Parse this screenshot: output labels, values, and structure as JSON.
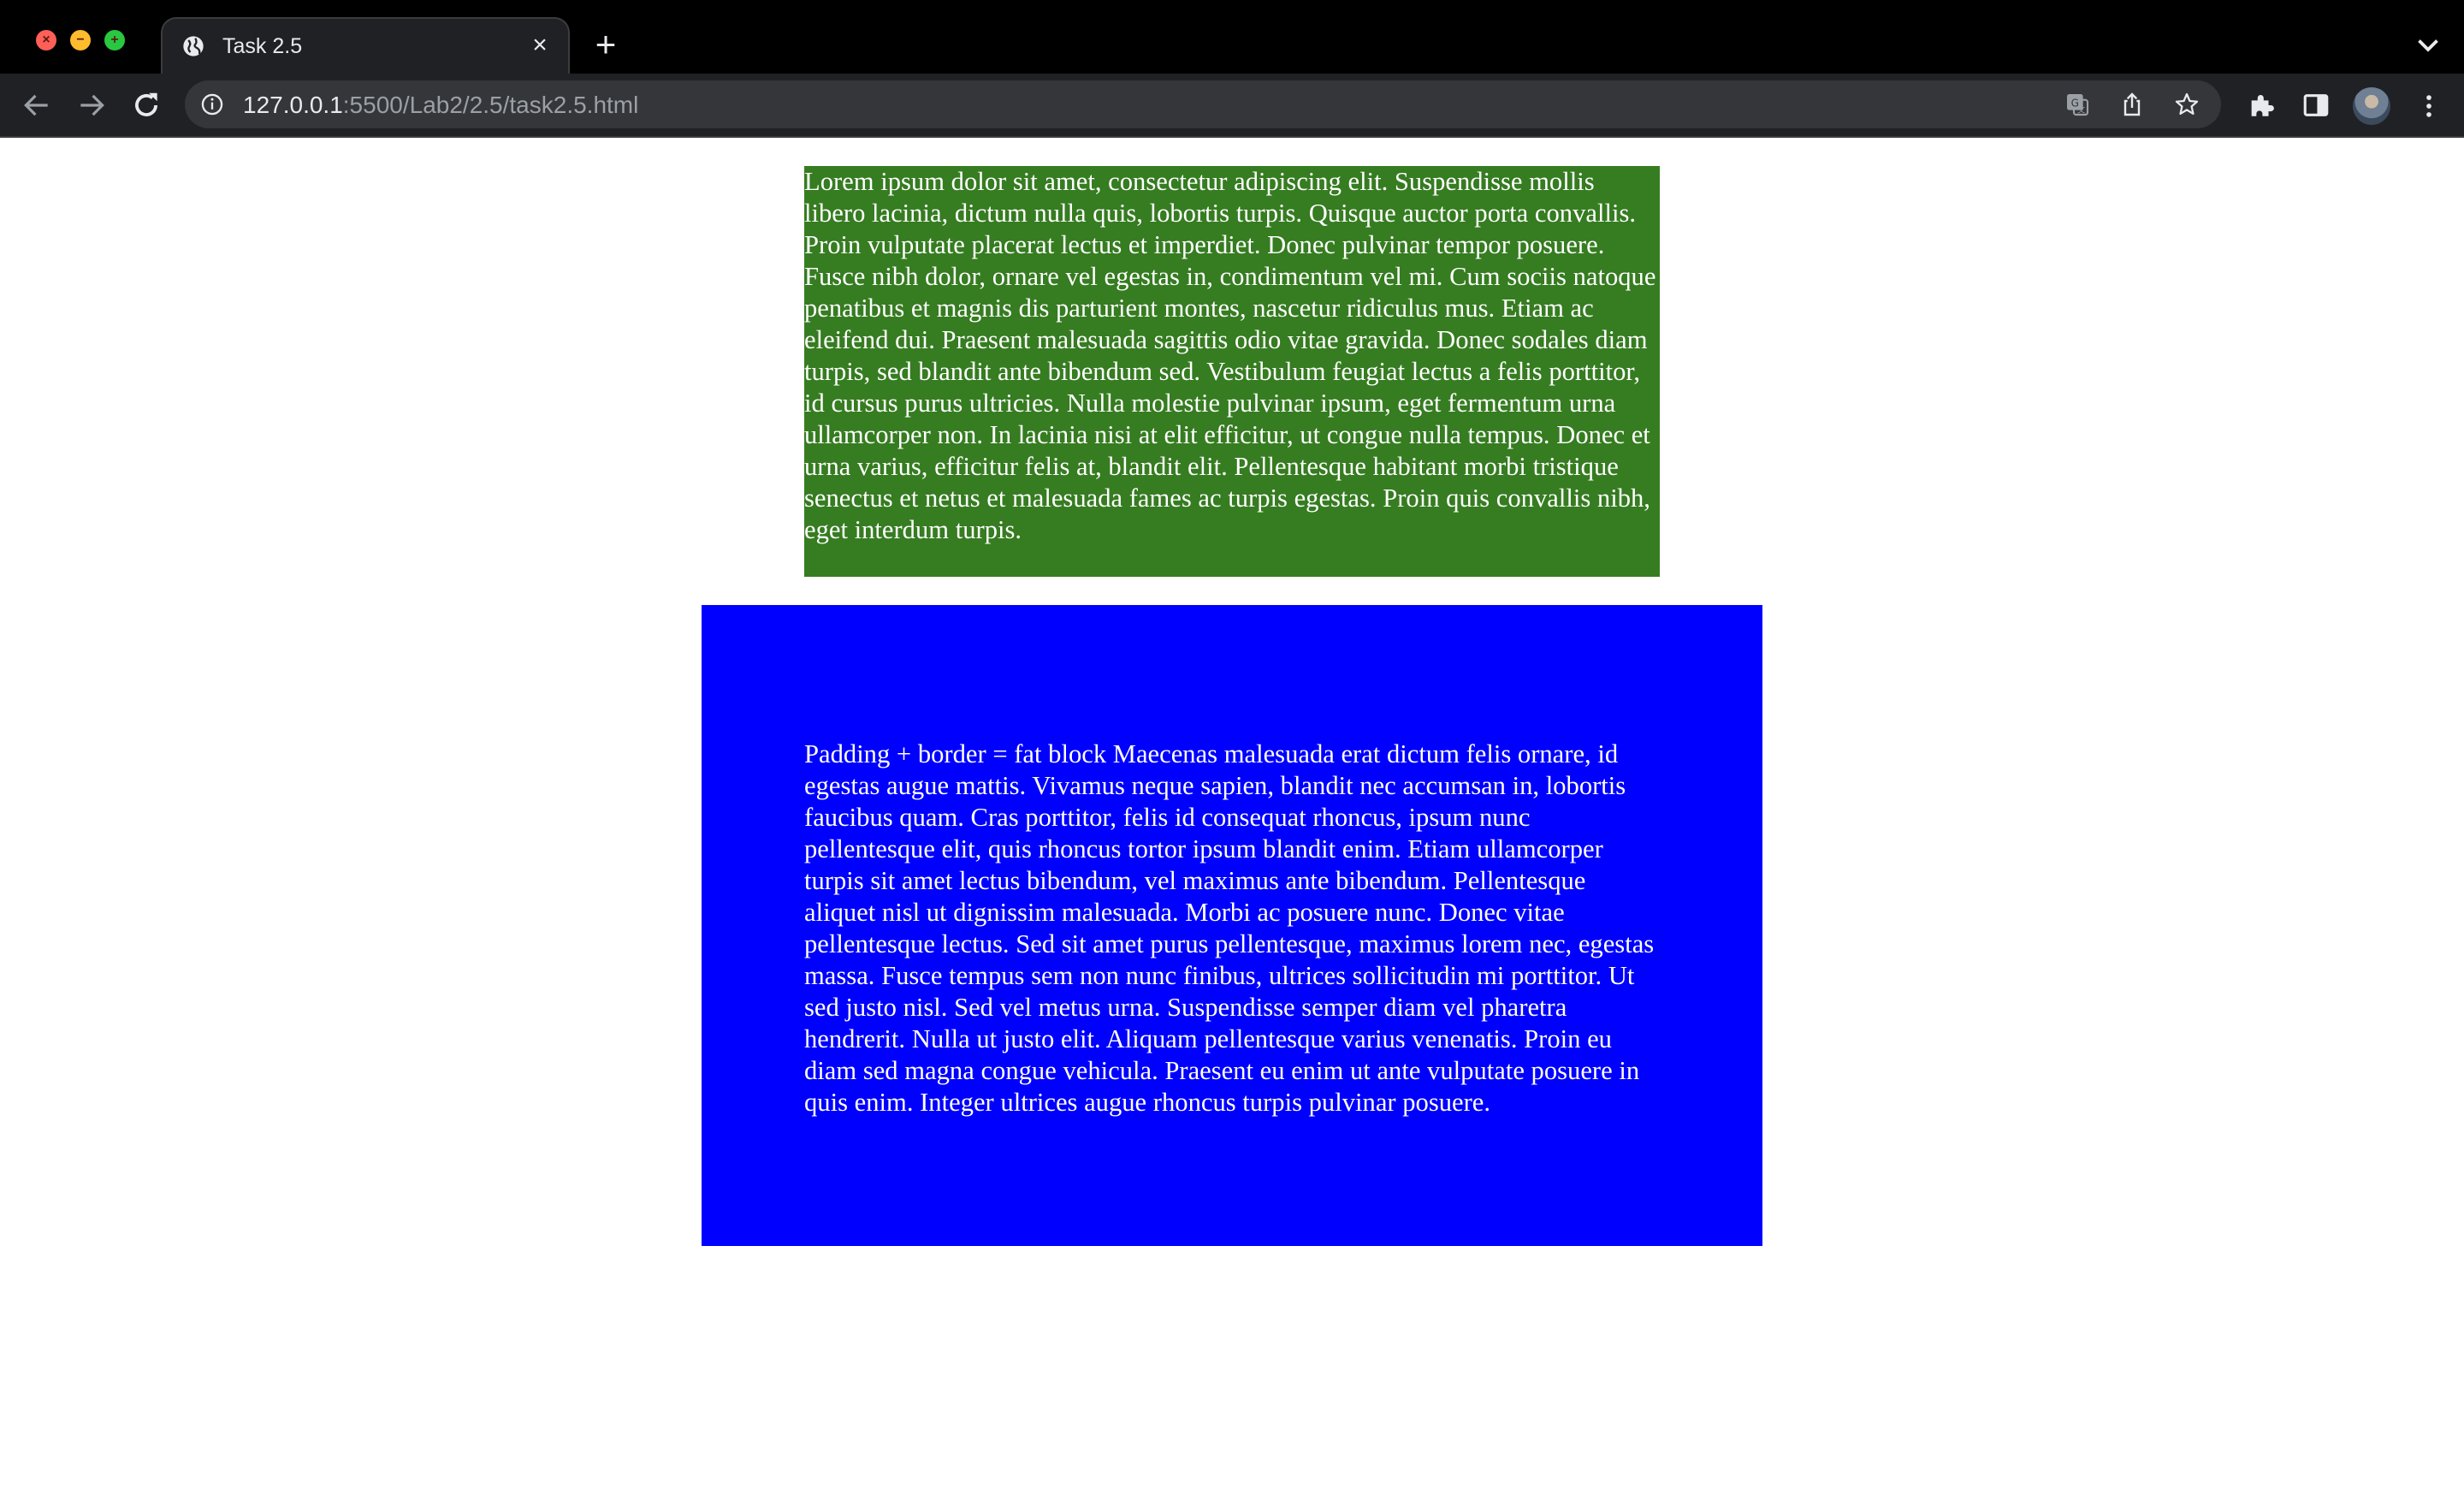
{
  "browser": {
    "tab": {
      "title": "Task 2.5"
    },
    "address_bar": {
      "host": "127.0.0.1",
      "path": ":5500/Lab2/2.5/task2.5.html"
    },
    "icons": [
      "close-window-icon",
      "minimize-window-icon",
      "maximize-window-icon",
      "globe-icon",
      "close-icon",
      "plus-icon",
      "chevron-down-icon",
      "arrow-left-icon",
      "arrow-right-icon",
      "reload-icon",
      "info-icon",
      "translate-icon",
      "share-icon",
      "star-icon",
      "puzzle-icon",
      "sidepanel-icon",
      "avatar",
      "kebab-menu-icon"
    ]
  },
  "page": {
    "green_block": {
      "text": "Lorem ipsum dolor sit amet, consectetur adipiscing elit. Suspendisse mollis libero lacinia, dictum nulla quis, lobortis turpis. Quisque auctor porta convallis. Proin vulputate placerat lectus et imperdiet. Donec pulvinar tempor posuere. Fusce nibh dolor, ornare vel egestas in, condimentum vel mi. Cum sociis natoque penatibus et magnis dis parturient montes, nascetur ridiculus mus. Etiam ac eleifend dui. Praesent malesuada sagittis odio vitae gravida. Donec sodales diam turpis, sed blandit ante bibendum sed. Vestibulum feugiat lectus a felis porttitor, id cursus purus ultricies. Nulla molestie pulvinar ipsum, eget fermentum urna ullamcorper non. In lacinia nisi at elit efficitur, ut congue nulla tempus. Donec et urna varius, efficitur felis at, blandit elit. Pellentesque habitant morbi tristique senectus et netus et malesuada fames ac turpis egestas. Proin quis convallis nibh, eget interdum turpis.",
      "color": "#367c21"
    },
    "blue_block": {
      "text": "Padding + border = fat block Maecenas malesuada erat dictum felis ornare, id egestas augue mattis. Vivamus neque sapien, blandit nec accumsan in, lobortis faucibus quam. Cras porttitor, felis id consequat rhoncus, ipsum nunc pellentesque elit, quis rhoncus tortor ipsum blandit enim. Etiam ullamcorper turpis sit amet lectus bibendum, vel maximus ante bibendum. Pellentesque aliquet nisl ut dignissim malesuada. Morbi ac posuere nunc. Donec vitae pellentesque lectus. Sed sit amet purus pellentesque, maximus lorem nec, egestas massa. Fusce tempus sem non nunc finibus, ultrices sollicitudin mi porttitor. Ut sed justo nisl. Sed vel metus urna. Suspendisse semper diam vel pharetra hendrerit. Nulla ut justo elit. Aliquam pellentesque varius venenatis. Proin eu diam sed magna congue vehicula. Praesent eu enim ut ante vulputate posuere in quis enim. Integer ultrices augue rhoncus turpis pulvinar posuere.",
      "color": "#0000fe"
    }
  }
}
